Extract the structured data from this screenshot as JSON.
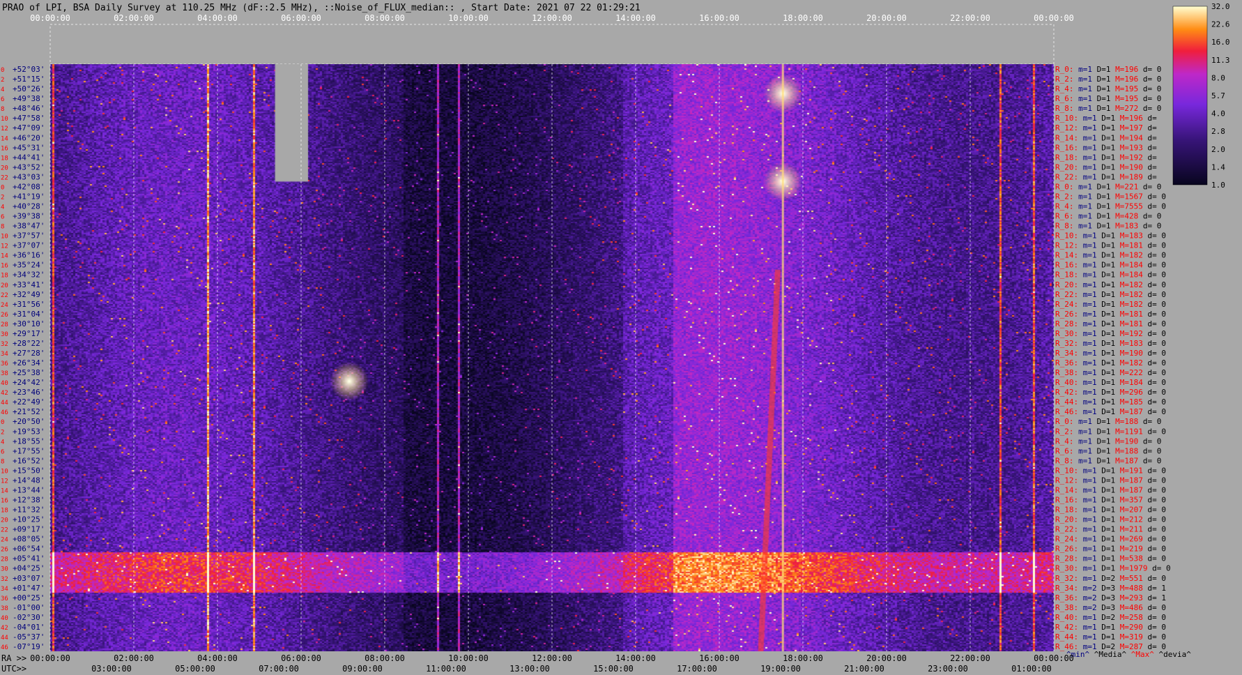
{
  "chart_data": {
    "type": "heatmap",
    "title": "PRAO of LPI, BSA Daily Survey at 110.25 MHz (dF::2.5 MHz), ::Noise_of_FLUX_median:: , Start Date: 2021 07 22 01:29:21",
    "top_ticks": [
      "00:00:00",
      "02:00:00",
      "04:00:00",
      "06:00:00",
      "08:00:00",
      "10:00:00",
      "12:00:00",
      "14:00:00",
      "16:00:00",
      "18:00:00",
      "20:00:00",
      "22:00:00",
      "00:00:00"
    ],
    "ra_prefix": "RA >>",
    "ra_ticks": [
      "00:00:00",
      "02:00:00",
      "04:00:00",
      "06:00:00",
      "08:00:00",
      "10:00:00",
      "12:00:00",
      "14:00:00",
      "16:00:00",
      "18:00:00",
      "20:00:00",
      "22:00:00",
      "00:00:00"
    ],
    "utc_prefix": "UTC>>",
    "utc_ticks": [
      "03:00:00",
      "05:00:00",
      "07:00:00",
      "09:00:00",
      "11:00:00",
      "13:00:00",
      "15:00:00",
      "17:00:00",
      "19:00:00",
      "21:00:00",
      "23:00:00",
      "01:00:00"
    ],
    "dec_labels": [
      "+52°03'",
      "+51°15'",
      "+50°26'",
      "+49°38'",
      "+48°46'",
      "+47°58'",
      "+47°09'",
      "+46°20'",
      "+45°31'",
      "+44°41'",
      "+43°52'",
      "+43°03'",
      "+42°08'",
      "+41°19'",
      "+40°28'",
      "+39°38'",
      "+38°47'",
      "+37°57'",
      "+37°07'",
      "+36°16'",
      "+35°24'",
      "+34°32'",
      "+33°41'",
      "+32°49'",
      "+31°56'",
      "+31°04'",
      "+30°10'",
      "+29°17'",
      "+28°22'",
      "+27°28'",
      "+26°34'",
      "+25°38'",
      "+24°42'",
      "+23°46'",
      "+22°49'",
      "+21°52'",
      "+20°50'",
      "+19°53'",
      "+18°55'",
      "+17°55'",
      "+16°52'",
      "+15°50'",
      "+14°48'",
      "+13°44'",
      "+12°38'",
      "+11°32'",
      "+10°25'",
      "+09°17'",
      "+08°05'",
      "+06°54'",
      "+05°41'",
      "+04°25'",
      "+03°07'",
      "+01°47'",
      "+00°25'",
      "-01°00'",
      "-02°30'",
      "-04°01'",
      "-05°37'",
      "-07°19'"
    ],
    "beam_numbers": [
      "0",
      "2",
      "4",
      "6",
      "8",
      "10",
      "12",
      "14",
      "16",
      "18",
      "20",
      "22",
      "0",
      "2",
      "4",
      "6",
      "8",
      "10",
      "12",
      "14",
      "16",
      "18",
      "20",
      "22",
      "24",
      "26",
      "28",
      "30",
      "32",
      "34",
      "36",
      "38",
      "40",
      "42",
      "44",
      "46",
      "0",
      "2",
      "4",
      "6",
      "8",
      "10",
      "12",
      "14",
      "16",
      "18",
      "20",
      "22",
      "24",
      "26",
      "28",
      "30",
      "32",
      "34",
      "36",
      "38",
      "40",
      "42",
      "44",
      "46"
    ],
    "colorbar": {
      "ticks": [
        "32.0",
        "22.6",
        "16.0",
        "11.3",
        "8.0",
        "5.7",
        "4.0",
        "2.8",
        "2.0",
        "1.4",
        "1.0"
      ]
    },
    "right_stats": [
      {
        "r": "R_0:",
        "m": "1",
        "d": "1",
        "M": "196",
        "dv": "0"
      },
      {
        "r": "R_2:",
        "m": "1",
        "d": "1",
        "M": "196",
        "dv": "0"
      },
      {
        "r": "R_4:",
        "m": "1",
        "d": "1",
        "M": "195",
        "dv": "0"
      },
      {
        "r": "R_6:",
        "m": "1",
        "d": "1",
        "M": "195",
        "dv": "0"
      },
      {
        "r": "R_8:",
        "m": "1",
        "d": "1",
        "M": "272",
        "dv": "0"
      },
      {
        "r": "R_10:",
        "m": "1",
        "d": "1",
        "M": "196",
        "dv": ""
      },
      {
        "r": "R_12:",
        "m": "1",
        "d": "1",
        "M": "197",
        "dv": ""
      },
      {
        "r": "R_14:",
        "m": "1",
        "d": "1",
        "M": "194",
        "dv": ""
      },
      {
        "r": "R_16:",
        "m": "1",
        "d": "1",
        "M": "193",
        "dv": ""
      },
      {
        "r": "R_18:",
        "m": "1",
        "d": "1",
        "M": "192",
        "dv": ""
      },
      {
        "r": "R_20:",
        "m": "1",
        "d": "1",
        "M": "190",
        "dv": ""
      },
      {
        "r": "R_22:",
        "m": "1",
        "d": "1",
        "M": "189",
        "dv": ""
      },
      {
        "r": "R_0:",
        "m": "1",
        "d": "1",
        "M": "221",
        "dv": "0"
      },
      {
        "r": "R_2:",
        "m": "1",
        "d": "1",
        "M": "1567",
        "dv": "0"
      },
      {
        "r": "R_4:",
        "m": "1",
        "d": "1",
        "M": "7555",
        "dv": "0"
      },
      {
        "r": "R_6:",
        "m": "1",
        "d": "1",
        "M": "428",
        "dv": "0"
      },
      {
        "r": "R_8:",
        "m": "1",
        "d": "1",
        "M": "183",
        "dv": "0"
      },
      {
        "r": "R_10:",
        "m": "1",
        "d": "1",
        "M": "183",
        "dv": "0"
      },
      {
        "r": "R_12:",
        "m": "1",
        "d": "1",
        "M": "181",
        "dv": "0"
      },
      {
        "r": "R_14:",
        "m": "1",
        "d": "1",
        "M": "182",
        "dv": "0"
      },
      {
        "r": "R_16:",
        "m": "1",
        "d": "1",
        "M": "184",
        "dv": "0"
      },
      {
        "r": "R_18:",
        "m": "1",
        "d": "1",
        "M": "184",
        "dv": "0"
      },
      {
        "r": "R_20:",
        "m": "1",
        "d": "1",
        "M": "182",
        "dv": "0"
      },
      {
        "r": "R_22:",
        "m": "1",
        "d": "1",
        "M": "182",
        "dv": "0"
      },
      {
        "r": "R_24:",
        "m": "1",
        "d": "1",
        "M": "182",
        "dv": "0"
      },
      {
        "r": "R_26:",
        "m": "1",
        "d": "1",
        "M": "181",
        "dv": "0"
      },
      {
        "r": "R_28:",
        "m": "1",
        "d": "1",
        "M": "181",
        "dv": "0"
      },
      {
        "r": "R_30:",
        "m": "1",
        "d": "1",
        "M": "192",
        "dv": "0"
      },
      {
        "r": "R_32:",
        "m": "1",
        "d": "1",
        "M": "183",
        "dv": "0"
      },
      {
        "r": "R_34:",
        "m": "1",
        "d": "1",
        "M": "190",
        "dv": "0"
      },
      {
        "r": "R_36:",
        "m": "1",
        "d": "1",
        "M": "182",
        "dv": "0"
      },
      {
        "r": "R_38:",
        "m": "1",
        "d": "1",
        "M": "222",
        "dv": "0"
      },
      {
        "r": "R_40:",
        "m": "1",
        "d": "1",
        "M": "184",
        "dv": "0"
      },
      {
        "r": "R_42:",
        "m": "1",
        "d": "1",
        "M": "296",
        "dv": "0"
      },
      {
        "r": "R_44:",
        "m": "1",
        "d": "1",
        "M": "185",
        "dv": "0"
      },
      {
        "r": "R_46:",
        "m": "1",
        "d": "1",
        "M": "187",
        "dv": "0"
      },
      {
        "r": "R_0:",
        "m": "1",
        "d": "1",
        "M": "188",
        "dv": "0"
      },
      {
        "r": "R_2:",
        "m": "1",
        "d": "1",
        "M": "1191",
        "dv": "0"
      },
      {
        "r": "R_4:",
        "m": "1",
        "d": "1",
        "M": "190",
        "dv": "0"
      },
      {
        "r": "R_6:",
        "m": "1",
        "d": "1",
        "M": "188",
        "dv": "0"
      },
      {
        "r": "R_8:",
        "m": "1",
        "d": "1",
        "M": "187",
        "dv": "0"
      },
      {
        "r": "R_10:",
        "m": "1",
        "d": "1",
        "M": "191",
        "dv": "0"
      },
      {
        "r": "R_12:",
        "m": "1",
        "d": "1",
        "M": "187",
        "dv": "0"
      },
      {
        "r": "R_14:",
        "m": "1",
        "d": "1",
        "M": "187",
        "dv": "0"
      },
      {
        "r": "R_16:",
        "m": "1",
        "d": "1",
        "M": "357",
        "dv": "0"
      },
      {
        "r": "R_18:",
        "m": "1",
        "d": "1",
        "M": "207",
        "dv": "0"
      },
      {
        "r": "R_20:",
        "m": "1",
        "d": "1",
        "M": "212",
        "dv": "0"
      },
      {
        "r": "R_22:",
        "m": "1",
        "d": "1",
        "M": "211",
        "dv": "0"
      },
      {
        "r": "R_24:",
        "m": "1",
        "d": "1",
        "M": "269",
        "dv": "0"
      },
      {
        "r": "R_26:",
        "m": "1",
        "d": "1",
        "M": "219",
        "dv": "0"
      },
      {
        "r": "R_28:",
        "m": "1",
        "d": "1",
        "M": "538",
        "dv": "0"
      },
      {
        "r": "R_30:",
        "m": "1",
        "d": "1",
        "M": "1979",
        "dv": "0"
      },
      {
        "r": "R_32:",
        "m": "1",
        "d": "2",
        "M": "551",
        "dv": "0"
      },
      {
        "r": "R_34:",
        "m": "2",
        "d": "3",
        "M": "488",
        "dv": "1"
      },
      {
        "r": "R_36:",
        "m": "2",
        "d": "3",
        "M": "293",
        "dv": "1"
      },
      {
        "r": "R_38:",
        "m": "2",
        "d": "3",
        "M": "486",
        "dv": "0"
      },
      {
        "r": "R_40:",
        "m": "1",
        "d": "2",
        "M": "258",
        "dv": "0"
      },
      {
        "r": "R_42:",
        "m": "1",
        "d": "1",
        "M": "290",
        "dv": "0"
      },
      {
        "r": "R_44:",
        "m": "1",
        "d": "1",
        "M": "319",
        "dv": "0"
      },
      {
        "r": "R_46:",
        "m": "1",
        "d": "2",
        "M": "287",
        "dv": "0"
      }
    ],
    "stats_field_labels": {
      "m": "m=",
      "d": "D=",
      "M": "M=",
      "dv": "d="
    },
    "stats_legend": [
      {
        "text": "^min^",
        "color": "#000080"
      },
      {
        "text": "^Media^",
        "color": "#000000"
      },
      {
        "text": "^Max^",
        "color": "#ff0000"
      },
      {
        "text": "^devia^",
        "color": "#000000"
      }
    ],
    "colors": {
      "background": "#a8a8a8",
      "label_red": "#ff0000",
      "label_blue": "#000080",
      "dec_blue": "#00007a"
    }
  }
}
